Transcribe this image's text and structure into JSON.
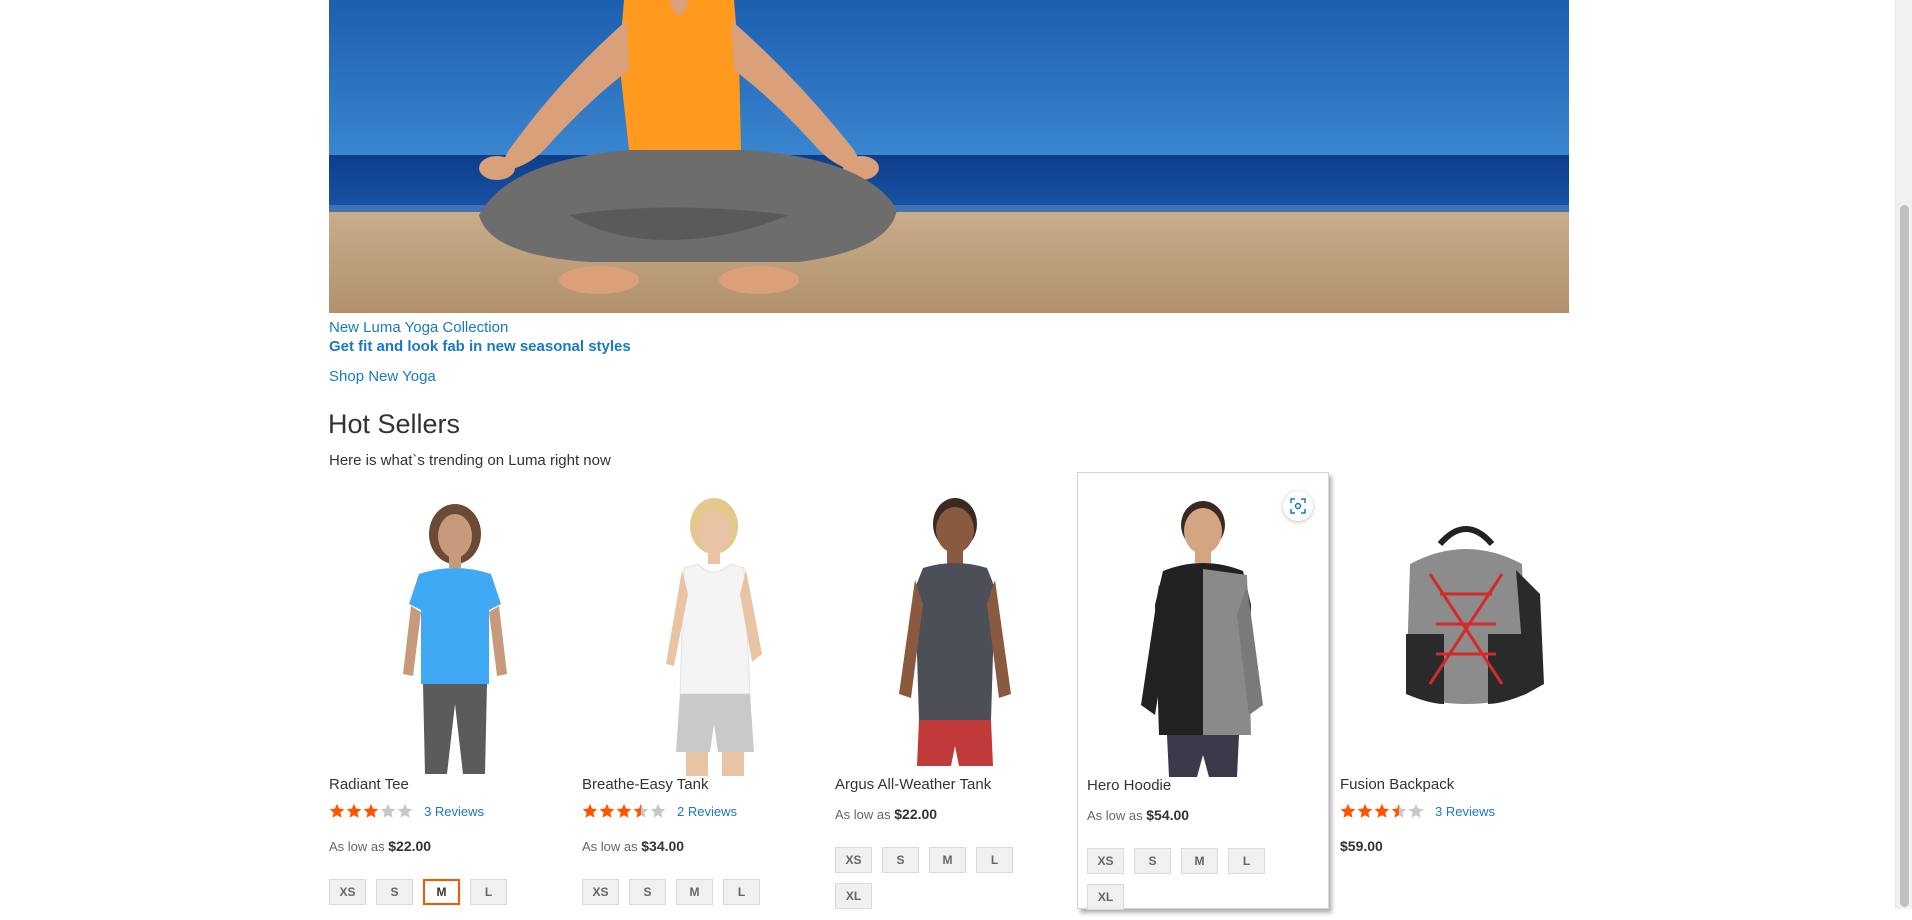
{
  "promo": {
    "title": "New Luma Yoga Collection",
    "subtitle": "Get fit and look fab in new seasonal styles",
    "shop_link": "Shop New Yoga"
  },
  "hot_sellers": {
    "title": "Hot Sellers",
    "description": "Here is what`s trending on Luma right now"
  },
  "colors": {
    "link": "#1979c3",
    "star_filled": "#ff5501",
    "star_empty": "#c7c7c7",
    "selected_swatch_border": "#ff5501"
  },
  "products": [
    {
      "name": "Radiant Tee",
      "rating_fraction": 0.6,
      "reviews": "3 Reviews",
      "price_prefix": "As low as",
      "price": "$22.00",
      "sizes": [
        "XS",
        "S",
        "M",
        "L"
      ],
      "selected_size": "M",
      "image_icon": "blue-tee-photo"
    },
    {
      "name": "Breathe-Easy Tank",
      "rating_fraction": 0.7,
      "reviews": "2 Reviews",
      "price_prefix": "As low as",
      "price": "$34.00",
      "sizes": [
        "XS",
        "S",
        "M",
        "L"
      ],
      "image_icon": "white-tank-photo"
    },
    {
      "name": "Argus All-Weather Tank",
      "price_prefix": "As low as",
      "price": "$22.00",
      "sizes": [
        "XS",
        "S",
        "M",
        "L",
        "XL"
      ],
      "image_icon": "grey-tank-photo"
    },
    {
      "name": "Hero Hoodie",
      "price_prefix": "As low as",
      "price": "$54.00",
      "sizes": [
        "XS",
        "S",
        "M",
        "L",
        "XL"
      ],
      "image_icon": "hoodie-photo",
      "quickview_icon": "quick-view-icon"
    },
    {
      "name": "Fusion Backpack",
      "rating_fraction": 0.7,
      "reviews": "3 Reviews",
      "price": "$59.00",
      "image_icon": "backpack-photo"
    }
  ]
}
